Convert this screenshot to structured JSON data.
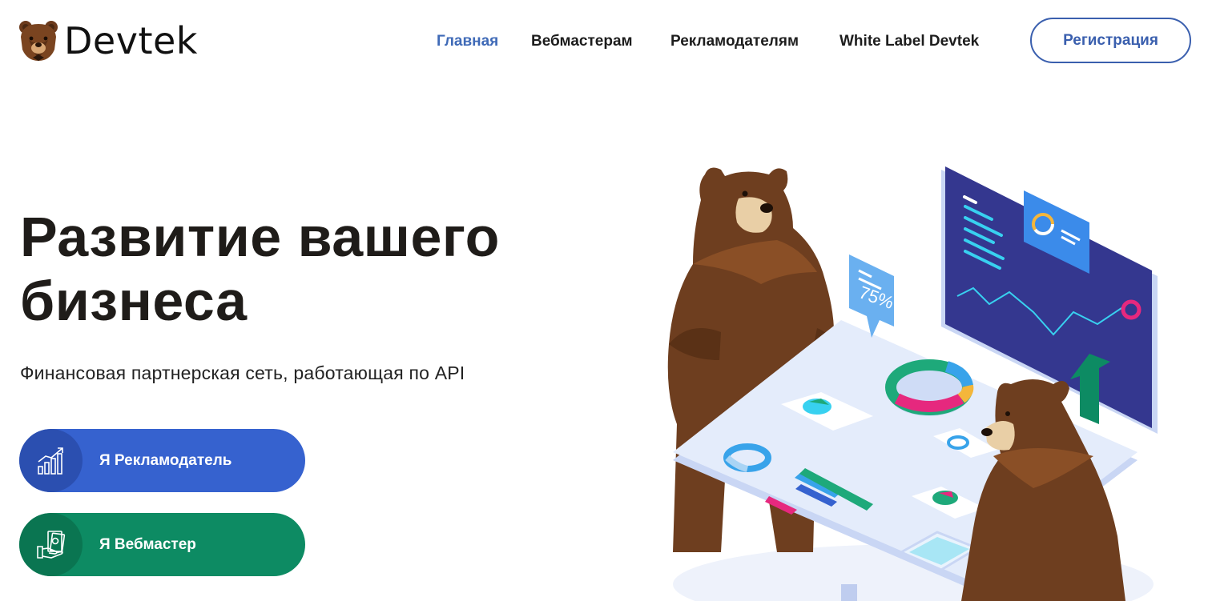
{
  "brand": {
    "name": "Devtek",
    "icon": "bear-logo-icon"
  },
  "nav": {
    "items": [
      {
        "label": "Главная",
        "active": true
      },
      {
        "label": "Вебмастерам",
        "active": false
      },
      {
        "label": "Рекламодателям",
        "active": false
      },
      {
        "label": "White Label Devtek",
        "active": false
      }
    ],
    "register_label": "Регистрация"
  },
  "hero": {
    "title_line1": "Развитие вашего",
    "title_line2": "бизнеса",
    "subtitle": "Финансовая партнерская сеть, работающая по API",
    "cta_advertiser": {
      "label": "Я Рекламодатель",
      "icon": "growth-chart-icon"
    },
    "cta_webmaster": {
      "label": "Я Вебмастер",
      "icon": "money-hand-icon"
    }
  },
  "illustration": {
    "badge_text": "75%",
    "colors": {
      "bear_brown": "#6e3e1f",
      "screen_navy": "#34378f",
      "accent_blue": "#3662cf",
      "accent_green": "#0d8b63",
      "table": "#dfe8fa"
    }
  }
}
